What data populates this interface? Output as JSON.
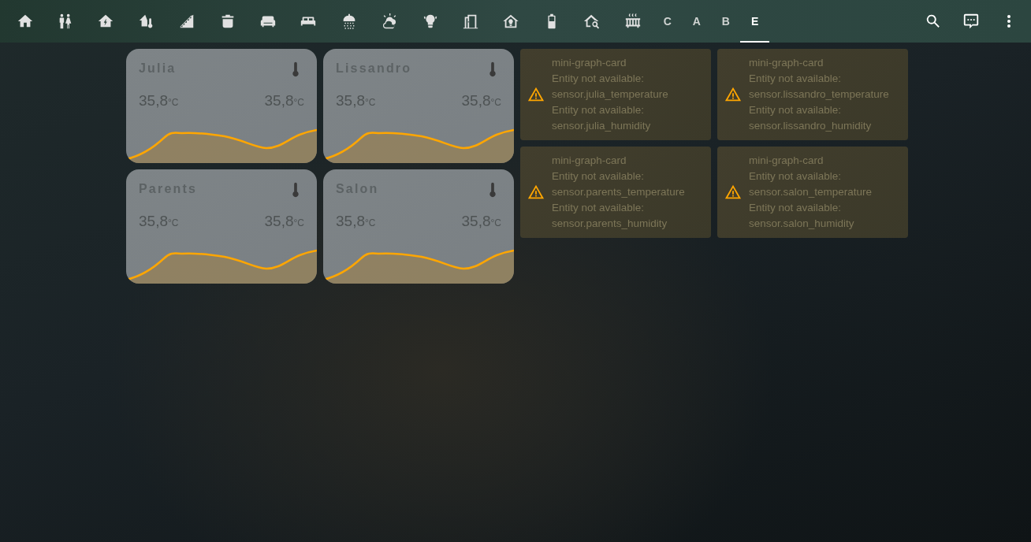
{
  "toolbar": {
    "icon_tabs": [
      {
        "selected": false
      },
      {
        "selected": false
      },
      {
        "selected": false
      },
      {
        "selected": false
      },
      {
        "selected": false
      },
      {
        "selected": false
      },
      {
        "selected": false
      },
      {
        "selected": false
      },
      {
        "selected": false
      },
      {
        "selected": false
      },
      {
        "selected": false
      },
      {
        "selected": false
      },
      {
        "selected": false
      },
      {
        "selected": false
      },
      {
        "selected": false
      },
      {
        "selected": false
      }
    ],
    "letter_tabs": [
      {
        "label": "C",
        "selected": false
      },
      {
        "label": "A",
        "selected": false
      },
      {
        "label": "B",
        "selected": false
      },
      {
        "label": "E",
        "selected": true
      }
    ]
  },
  "sensor_cards": [
    {
      "name": "Julia",
      "readings": [
        {
          "value": "35,8",
          "unit": "°C"
        },
        {
          "value": "35,8",
          "unit": "°C"
        }
      ]
    },
    {
      "name": "Parents",
      "readings": [
        {
          "value": "35,8",
          "unit": "°C"
        },
        {
          "value": "35,8",
          "unit": "°C"
        }
      ]
    },
    {
      "name": "Lissandro",
      "readings": [
        {
          "value": "35,8",
          "unit": "°C"
        },
        {
          "value": "35,8",
          "unit": "°C"
        }
      ]
    },
    {
      "name": "Salon",
      "readings": [
        {
          "value": "35,8",
          "unit": "°C"
        },
        {
          "value": "35,8",
          "unit": "°C"
        }
      ]
    }
  ],
  "error_cards": [
    {
      "lines": [
        "mini-graph-card",
        "Entity not available:",
        "sensor.julia_temperature",
        "Entity not available:",
        "sensor.julia_humidity"
      ]
    },
    {
      "lines": [
        "mini-graph-card",
        "Entity not available:",
        "sensor.parents_temperature",
        "Entity not available:",
        "sensor.parents_humidity"
      ]
    },
    {
      "lines": [
        "mini-graph-card",
        "Entity not available:",
        "sensor.lissandro_temperature",
        "Entity not available:",
        "sensor.lissandro_humidity"
      ]
    },
    {
      "lines": [
        "mini-graph-card",
        "Entity not available:",
        "sensor.salon_temperature",
        "Entity not available:",
        "sensor.salon_humidity"
      ]
    }
  ]
}
